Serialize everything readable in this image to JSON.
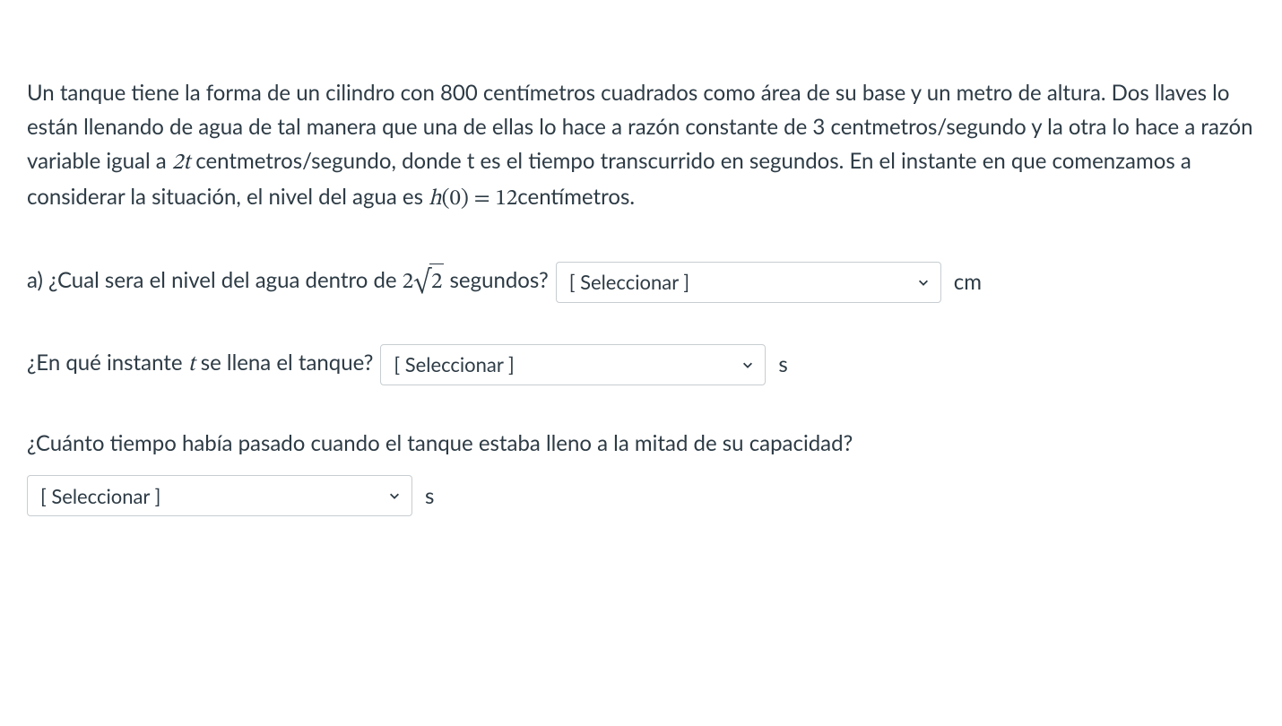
{
  "problem": {
    "text_pre": "Un tanque tiene la forma de un cilindro con 800 centímetros cuadrados como área de su base y un metro de altura. Dos llaves lo están llenando de agua de tal manera que una de ellas lo hace a razón constante de 3 centmetros/segundo y la otra lo hace a razón variable igual a ",
    "math_2t": "2t",
    "text_mid": " centmetros/segundo, donde t es el tiempo transcurrido en segundos. En el instante en que comenzamos a considerar la situación, el nivel del agua es ",
    "math_h0": "h(0) = 12",
    "text_post": "centímetros."
  },
  "question_a": {
    "prefix": "a) ¿Cual sera el nivel del agua dentro de  ",
    "math_two": "2",
    "sqrt_arg": "2",
    "suffix": " segundos?",
    "unit": "cm"
  },
  "question_b": {
    "prefix": "¿En qué instante ",
    "math_t": "t",
    "suffix": " se llena el tanque?",
    "unit": "s"
  },
  "question_c": {
    "text": "¿Cuánto tiempo había pasado cuando el tanque estaba lleno a la mitad de su capacidad?",
    "unit": "s"
  },
  "dropdown": {
    "placeholder": "[ Seleccionar ]"
  }
}
